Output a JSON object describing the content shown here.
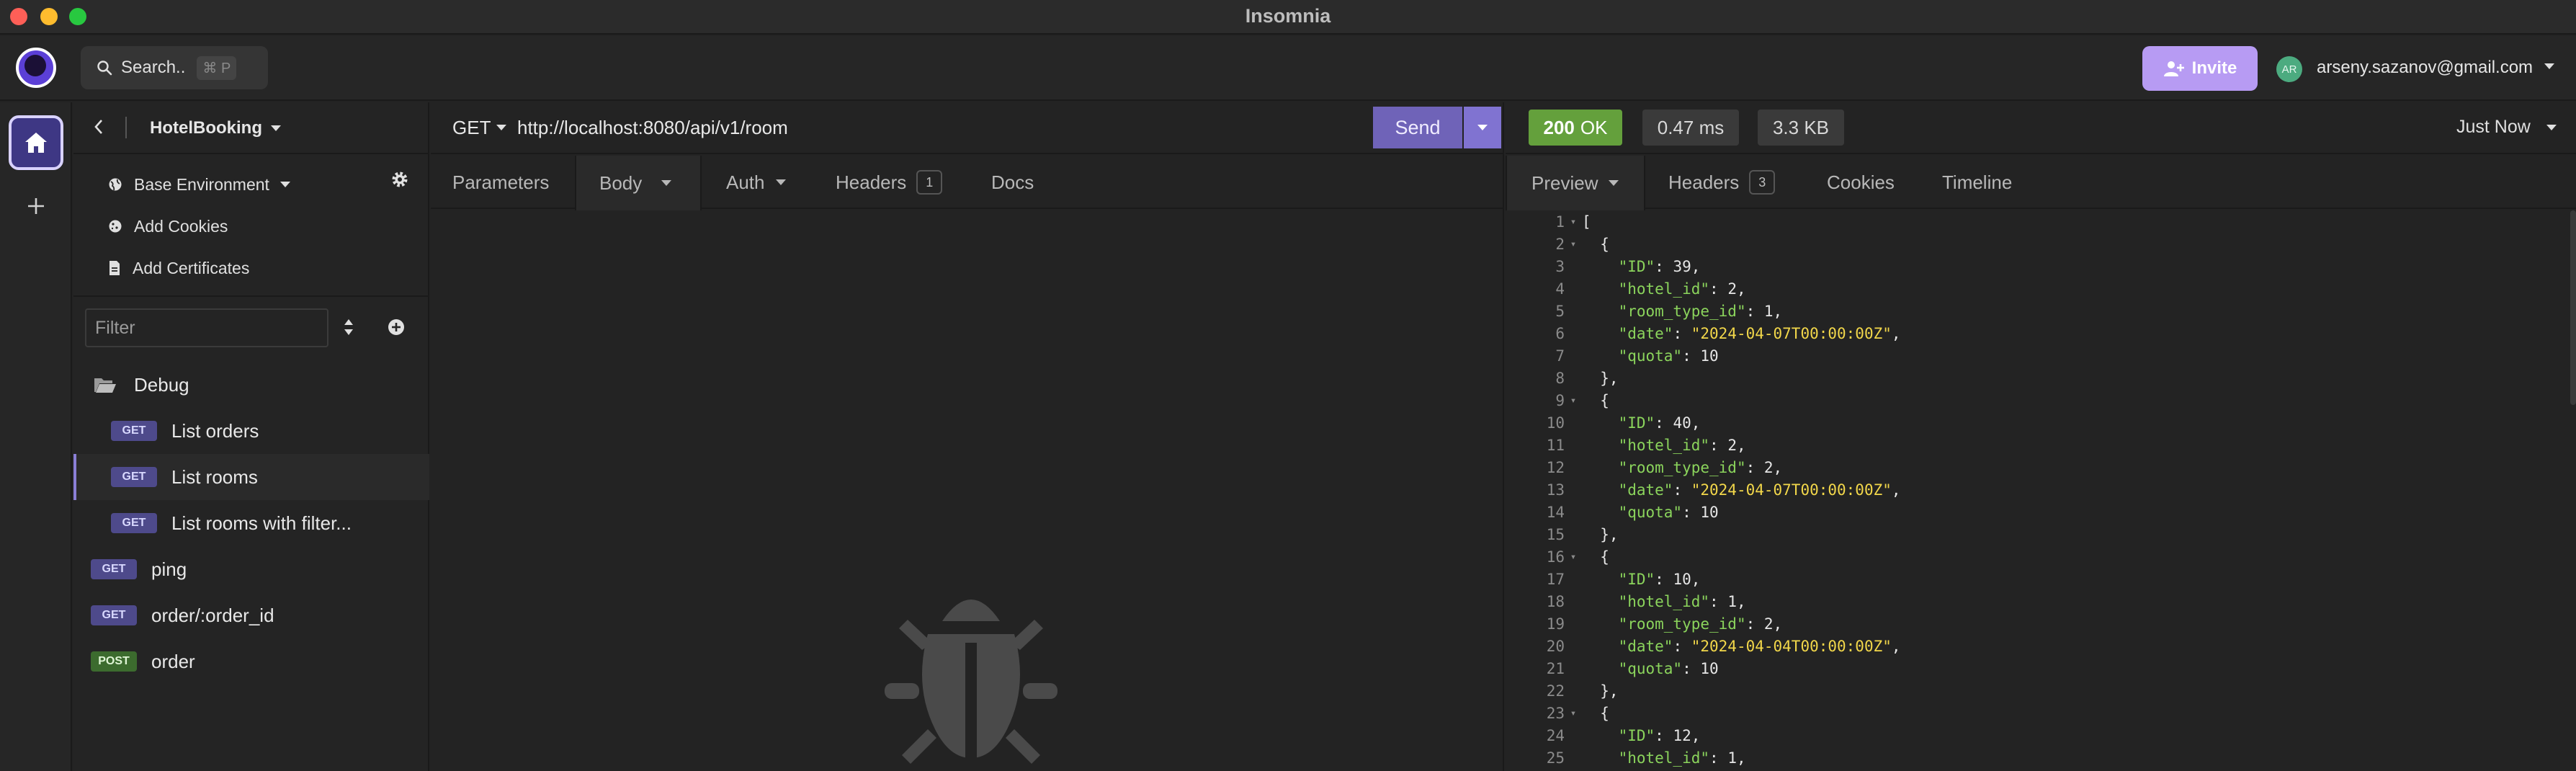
{
  "window": {
    "title": "Insomnia"
  },
  "topbar": {
    "search_label": "Search..",
    "search_shortcut": "⌘ P",
    "invite_label": "Invite",
    "avatar_initials": "AR",
    "user_email": "arseny.sazanov@gmail.com"
  },
  "sidebar": {
    "project_name": "HotelBooking",
    "environment": "Base Environment",
    "add_cookies": "Add Cookies",
    "add_certificates": "Add Certificates",
    "filter_placeholder": "Filter",
    "folder": "Debug",
    "items": [
      {
        "method": "GET",
        "name": "List orders"
      },
      {
        "method": "GET",
        "name": "List rooms"
      },
      {
        "method": "GET",
        "name": "List rooms with filter..."
      },
      {
        "method": "GET",
        "name": "ping"
      },
      {
        "method": "GET",
        "name": "order/:order_id"
      },
      {
        "method": "POST",
        "name": "order"
      }
    ]
  },
  "request": {
    "method": "GET",
    "url": "http://localhost:8080/api/v1/room",
    "send_label": "Send",
    "tabs": {
      "parameters": "Parameters",
      "body": "Body",
      "auth": "Auth",
      "headers": "Headers",
      "headers_count": "1",
      "docs": "Docs"
    }
  },
  "response": {
    "status_code": "200",
    "status_text": "OK",
    "time": "0.47 ms",
    "size": "3.3 KB",
    "timestamp": "Just Now",
    "tabs": {
      "preview": "Preview",
      "headers": "Headers",
      "headers_count": "3",
      "cookies": "Cookies",
      "timeline": "Timeline"
    },
    "lines": [
      {
        "n": "1",
        "fold": true,
        "text": "["
      },
      {
        "n": "2",
        "fold": true,
        "text": "  {"
      },
      {
        "n": "3",
        "key": "\"ID\"",
        "val": "39",
        "str": false,
        "comma": true
      },
      {
        "n": "4",
        "key": "\"hotel_id\"",
        "val": "2",
        "str": false,
        "comma": true
      },
      {
        "n": "5",
        "key": "\"room_type_id\"",
        "val": "1",
        "str": false,
        "comma": true
      },
      {
        "n": "6",
        "key": "\"date\"",
        "val": "\"2024-04-07T00:00:00Z\"",
        "str": true,
        "comma": true
      },
      {
        "n": "7",
        "key": "\"quota\"",
        "val": "10",
        "str": false,
        "comma": false
      },
      {
        "n": "8",
        "text": "  },"
      },
      {
        "n": "9",
        "fold": true,
        "text": "  {"
      },
      {
        "n": "10",
        "key": "\"ID\"",
        "val": "40",
        "str": false,
        "comma": true
      },
      {
        "n": "11",
        "key": "\"hotel_id\"",
        "val": "2",
        "str": false,
        "comma": true
      },
      {
        "n": "12",
        "key": "\"room_type_id\"",
        "val": "2",
        "str": false,
        "comma": true
      },
      {
        "n": "13",
        "key": "\"date\"",
        "val": "\"2024-04-07T00:00:00Z\"",
        "str": true,
        "comma": true
      },
      {
        "n": "14",
        "key": "\"quota\"",
        "val": "10",
        "str": false,
        "comma": false
      },
      {
        "n": "15",
        "text": "  },"
      },
      {
        "n": "16",
        "fold": true,
        "text": "  {"
      },
      {
        "n": "17",
        "key": "\"ID\"",
        "val": "10",
        "str": false,
        "comma": true
      },
      {
        "n": "18",
        "key": "\"hotel_id\"",
        "val": "1",
        "str": false,
        "comma": true
      },
      {
        "n": "19",
        "key": "\"room_type_id\"",
        "val": "2",
        "str": false,
        "comma": true
      },
      {
        "n": "20",
        "key": "\"date\"",
        "val": "\"2024-04-04T00:00:00Z\"",
        "str": true,
        "comma": true
      },
      {
        "n": "21",
        "key": "\"quota\"",
        "val": "10",
        "str": false,
        "comma": false
      },
      {
        "n": "22",
        "text": "  },"
      },
      {
        "n": "23",
        "fold": true,
        "text": "  {"
      },
      {
        "n": "24",
        "key": "\"ID\"",
        "val": "12",
        "str": false,
        "comma": true
      },
      {
        "n": "25",
        "key": "\"hotel_id\"",
        "val": "1",
        "str": false,
        "comma": true
      }
    ]
  }
}
